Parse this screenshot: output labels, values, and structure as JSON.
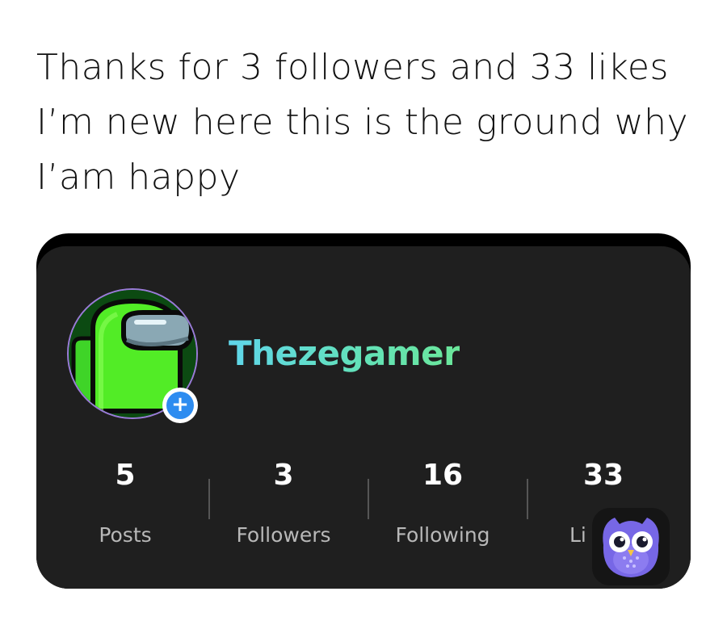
{
  "caption": "Thanks for 3 followers and 33 likes I’m new here this is the ground why I’am happy",
  "profile": {
    "username": "Thezegamer",
    "avatar_icon": "crewmate-avatar-icon",
    "add_icon": "plus-icon",
    "add_symbol": "+",
    "colors": {
      "username_gradient": [
        "#5fd6ea",
        "#6be79a"
      ],
      "card_background": "#1f1f1f",
      "badge_blue": "#2d8cf0",
      "avatar_ring": "#9a7bd8"
    }
  },
  "stats": [
    {
      "value": "5",
      "label": "Posts"
    },
    {
      "value": "3",
      "label": "Followers"
    },
    {
      "value": "16",
      "label": "Following"
    },
    {
      "value": "33",
      "label": "Li"
    }
  ],
  "watermark": {
    "icon": "owl-app-icon"
  }
}
